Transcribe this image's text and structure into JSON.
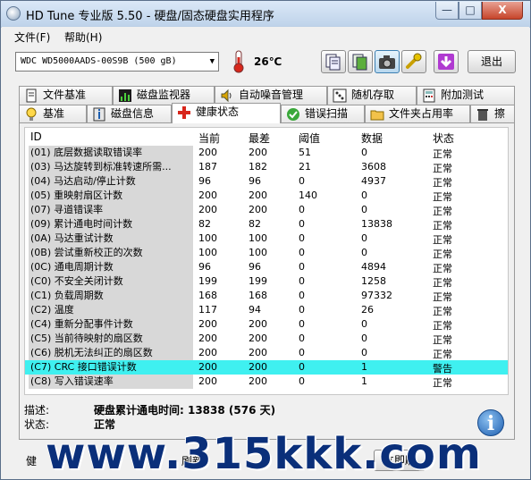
{
  "window": {
    "title": "HD Tune 专业版 5.50 - 硬盘/固态硬盘实用程序",
    "min": "—",
    "max": "□",
    "close": "X"
  },
  "menu": {
    "file": "文件(F)",
    "help": "帮助(H)"
  },
  "toolbar": {
    "drive": "WDC WD5000AADS-00S9B (500 gB)",
    "temperature": "26℃",
    "exit": "退出"
  },
  "tabs_top": [
    "文件基准",
    "磁盘监视器",
    "自动噪音管理",
    "随机存取",
    "附加测试"
  ],
  "tabs_bottom": [
    "基准",
    "磁盘信息",
    "健康状态",
    "错误扫描",
    "文件夹占用率",
    "擦除"
  ],
  "table": {
    "headers": [
      "ID",
      "当前",
      "最差",
      "阈值",
      "数据",
      "状态"
    ],
    "rows": [
      [
        "(01) 底层数据读取错误率",
        "200",
        "200",
        "51",
        "0",
        "正常"
      ],
      [
        "(03) 马达旋转到标准转速所需...",
        "187",
        "182",
        "21",
        "3608",
        "正常"
      ],
      [
        "(04) 马达启动/停止计数",
        "96",
        "96",
        "0",
        "4937",
        "正常"
      ],
      [
        "(05) 重映射扇区计数",
        "200",
        "200",
        "140",
        "0",
        "正常"
      ],
      [
        "(07) 寻道错误率",
        "200",
        "200",
        "0",
        "0",
        "正常"
      ],
      [
        "(09) 累计通电时间计数",
        "82",
        "82",
        "0",
        "13838",
        "正常"
      ],
      [
        "(0A) 马达重试计数",
        "100",
        "100",
        "0",
        "0",
        "正常"
      ],
      [
        "(0B) 尝试重新校正的次数",
        "100",
        "100",
        "0",
        "0",
        "正常"
      ],
      [
        "(0C) 通电周期计数",
        "96",
        "96",
        "0",
        "4894",
        "正常"
      ],
      [
        "(C0) 不安全关闭计数",
        "199",
        "199",
        "0",
        "1258",
        "正常"
      ],
      [
        "(C1) 负载周期数",
        "168",
        "168",
        "0",
        "97332",
        "正常"
      ],
      [
        "(C2) 温度",
        "117",
        "94",
        "0",
        "26",
        "正常"
      ],
      [
        "(C4) 重新分配事件计数",
        "200",
        "200",
        "0",
        "0",
        "正常"
      ],
      [
        "(C5) 当前待映射的扇区数",
        "200",
        "200",
        "0",
        "0",
        "正常"
      ],
      [
        "(C6) 脱机无法纠正的扇区数",
        "200",
        "200",
        "0",
        "0",
        "正常"
      ],
      [
        "(C7) CRC 接口错误计数",
        "200",
        "200",
        "0",
        "1",
        "警告"
      ],
      [
        "(C8) 写入错误速率",
        "200",
        "200",
        "0",
        "1",
        "正常"
      ]
    ]
  },
  "description": {
    "label": "描述:",
    "value": "硬盘累计通电时间: 13838 (576 天)",
    "status_label": "状态:",
    "status_value": "正常"
  },
  "statusbar": {
    "left_label": "健",
    "mid_label": "刷新",
    "button": "立即刷"
  },
  "watermark": "www.315kkk.com",
  "colors": {
    "highlight": "#3ff0f0",
    "accent": "#1e5fb0"
  }
}
